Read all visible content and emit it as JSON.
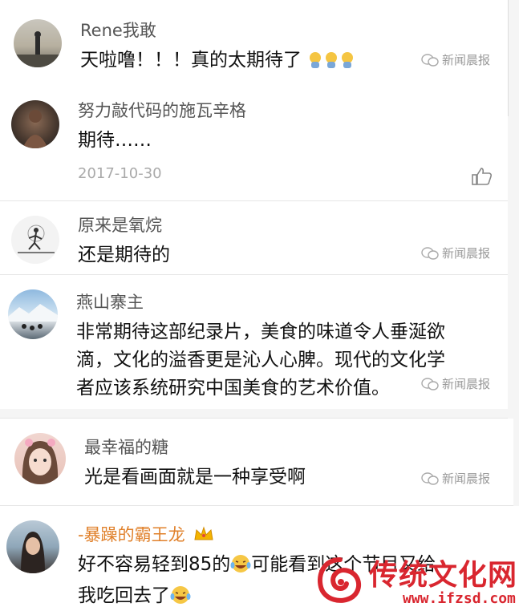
{
  "watermark": "新闻晨报",
  "comments": [
    {
      "name": "Rene我敢",
      "text": "天啦噜！！！真的太期待了",
      "emoji_count": 3
    },
    {
      "name": "努力敲代码的施瓦辛格",
      "text": "期待……",
      "date": "2017-10-30"
    },
    {
      "name": "原来是氧烷",
      "text": "还是期待的"
    },
    {
      "name": "燕山寨主",
      "lines": [
        "非常期待这部纪录片，美食的味道令人垂涎欲",
        "滴，文化的溢香更是沁人心脾。现代的文化学",
        "者应该系统研究中国美食的艺术价值。"
      ]
    },
    {
      "name": "最幸福的糖",
      "text": "光是看画面就是一种享受啊"
    },
    {
      "name": "-暴躁的霸王龙",
      "line1_a": "好不容易轻到85的",
      "line1_b": "可能看到这个节目又给",
      "line2": "我吃回去了"
    }
  ],
  "logo": {
    "text": "传统文化网",
    "url": "www.ifzsd.com"
  },
  "colors": {
    "accent": "#d9262f",
    "vip_name": "#e0802a"
  },
  "icons": [
    "wechat-icon",
    "thumbs-up-icon",
    "crown-icon",
    "laughing-crying-emoji",
    "praying-emoji"
  ]
}
